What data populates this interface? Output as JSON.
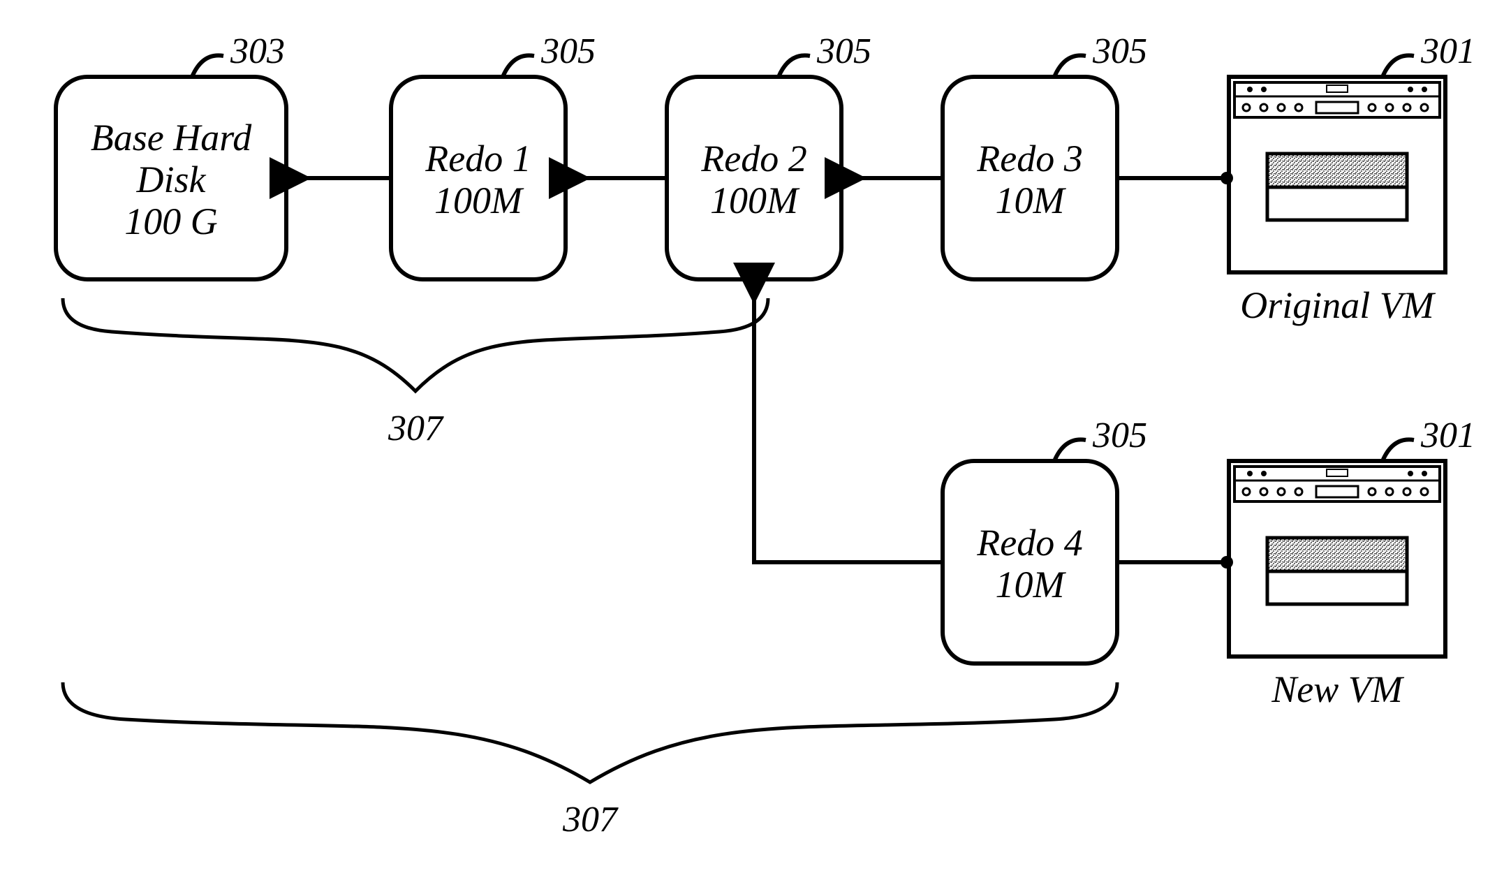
{
  "refs": {
    "base": "303",
    "redo": "305",
    "vm": "301",
    "brace": "307"
  },
  "nodes": {
    "base": {
      "l1": "Base Hard",
      "l2": "Disk",
      "l3": "100 G"
    },
    "r1": {
      "l1": "Redo 1",
      "l2": "100M"
    },
    "r2": {
      "l1": "Redo 2",
      "l2": "100M"
    },
    "r3": {
      "l1": "Redo 3",
      "l2": "10M"
    },
    "r4": {
      "l1": "Redo 4",
      "l2": "10M"
    }
  },
  "vm_labels": {
    "original": "Original VM",
    "new": "New VM"
  }
}
